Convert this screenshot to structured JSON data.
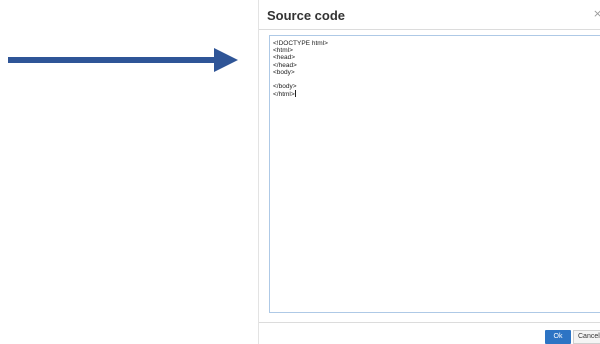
{
  "dialog": {
    "title": "Source code",
    "close_glyph": "×",
    "source_code": "<!DOCTYPE html>\n<html>\n<head>\n</head>\n<body>\n\n</body>\n</html>",
    "ok_label": "Ok",
    "cancel_label": "Cancel"
  },
  "colors": {
    "arrow": "#2f5597",
    "ok_button": "#2d74c4",
    "textarea_border": "#aec9e6"
  },
  "icons": {
    "annotation": "arrow-right-icon",
    "close": "close-icon"
  }
}
